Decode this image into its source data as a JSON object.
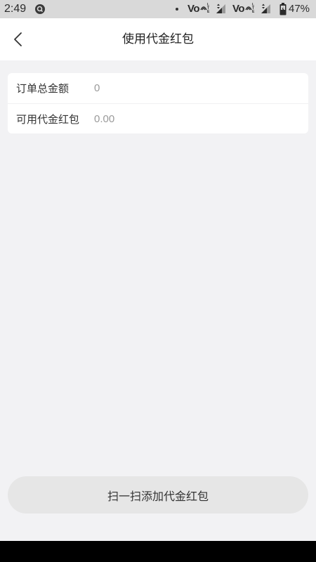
{
  "status_bar": {
    "time": "2:49",
    "battery_percent": "47%",
    "volte_label": "Vo",
    "lte_label": "LTE",
    "icons": [
      "notification-app-icon",
      "notification-dot-icon",
      "volte-icon",
      "signal-icon",
      "volte-icon",
      "signal-icon",
      "battery-icon"
    ]
  },
  "header": {
    "title": "使用代金红包",
    "back_icon": "chevron-left-icon"
  },
  "summary": {
    "rows": [
      {
        "label": "订单总金额",
        "value": "0"
      },
      {
        "label": "可用代金红包",
        "value": "0.00"
      }
    ]
  },
  "scan_button": {
    "label": "扫一扫添加代金红包"
  },
  "colors": {
    "page_background": "#f2f2f4",
    "status_bar": "#d9d9d9",
    "card": "#ffffff",
    "button": "#e6e6e6",
    "value_text": "#9a9a9a",
    "nav_bar": "#000000"
  }
}
